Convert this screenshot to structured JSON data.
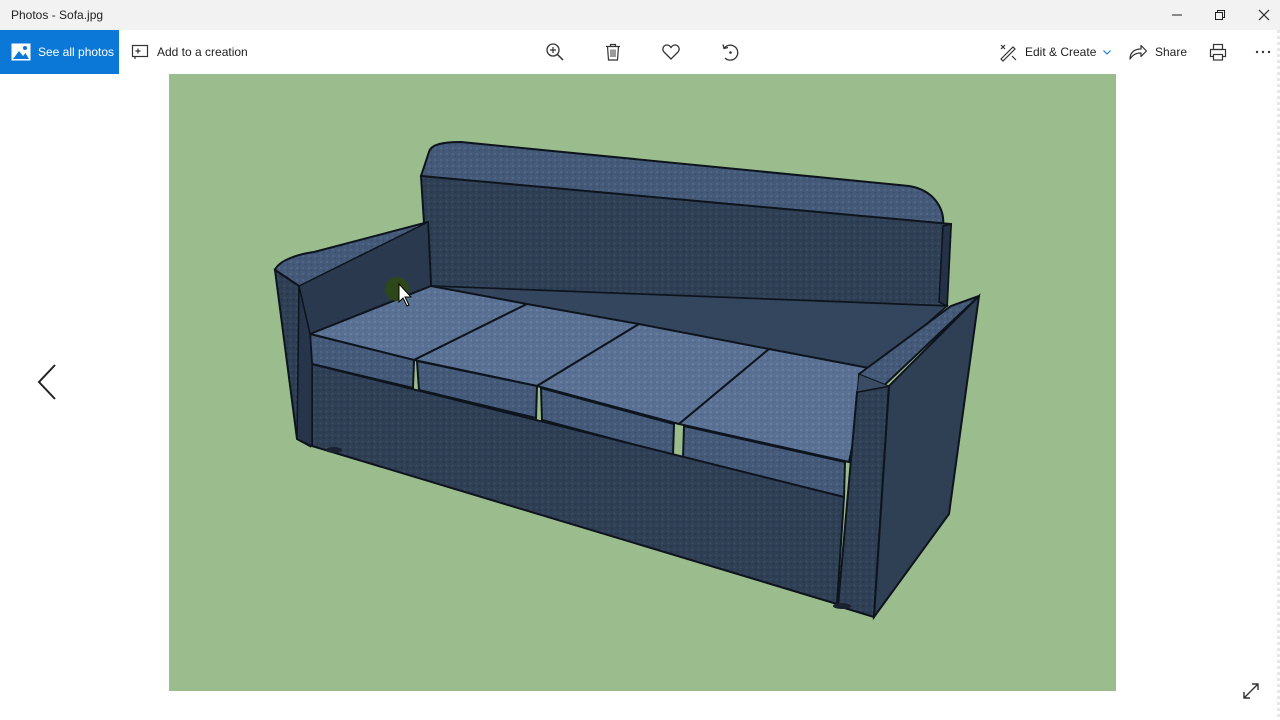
{
  "window": {
    "title": "Photos - Sofa.jpg",
    "controls": {
      "minimize_icon": "minimize-icon",
      "restore_icon": "restore-icon",
      "close_icon": "close-icon"
    }
  },
  "toolbar": {
    "see_all_photos": "See all photos",
    "add_to_creation": "Add to a creation",
    "center_icons": [
      "zoom-in-icon",
      "delete-icon",
      "favorite-icon",
      "rotate-icon"
    ],
    "edit_create": "Edit & Create",
    "share": "Share",
    "print_icon": "print-icon",
    "more_icon": "more-icon"
  },
  "viewer": {
    "image_background": "#9bbd8d",
    "nav_previous_icon": "chevron-left-icon",
    "expand_icon": "expand-icon"
  },
  "colors": {
    "accent": "#0b78d7",
    "titlebar": "#f2f2f2",
    "sofa": "#2e3e52"
  }
}
